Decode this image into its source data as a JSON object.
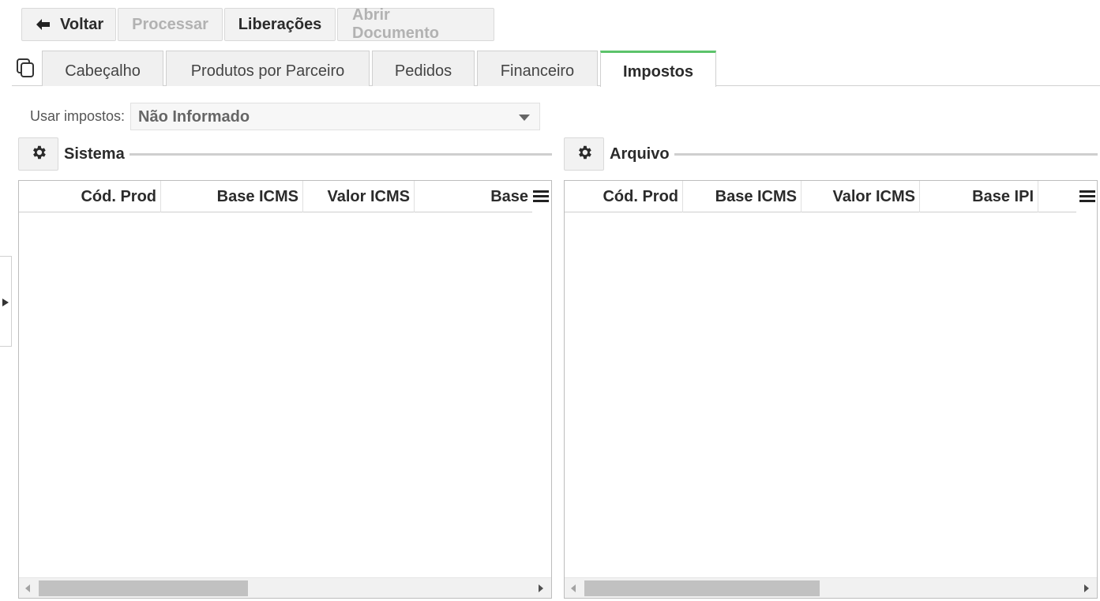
{
  "toolbar": {
    "voltar": "Voltar",
    "processar": "Processar",
    "liberacoes": "Liberações",
    "abrir_documento": "Abrir Documento"
  },
  "tabs": [
    {
      "label": "Cabeçalho",
      "active": false
    },
    {
      "label": "Produtos por Parceiro",
      "active": false
    },
    {
      "label": "Pedidos",
      "active": false
    },
    {
      "label": "Financeiro",
      "active": false
    },
    {
      "label": "Impostos",
      "active": true
    }
  ],
  "usar_impostos": {
    "label": "Usar impostos:",
    "value": "Não Informado"
  },
  "sistema": {
    "title": "Sistema",
    "columns": [
      "Cód. Prod",
      "Base ICMS",
      "Valor ICMS",
      "Base"
    ]
  },
  "arquivo": {
    "title": "Arquivo",
    "columns": [
      "Cód. Prod",
      "Base ICMS",
      "Valor ICMS",
      "Base IPI"
    ]
  },
  "colors": {
    "active_tab_accent": "#5cc36a",
    "button_bg": "#f2f2f2",
    "disabled_text": "#b2b2b2"
  }
}
